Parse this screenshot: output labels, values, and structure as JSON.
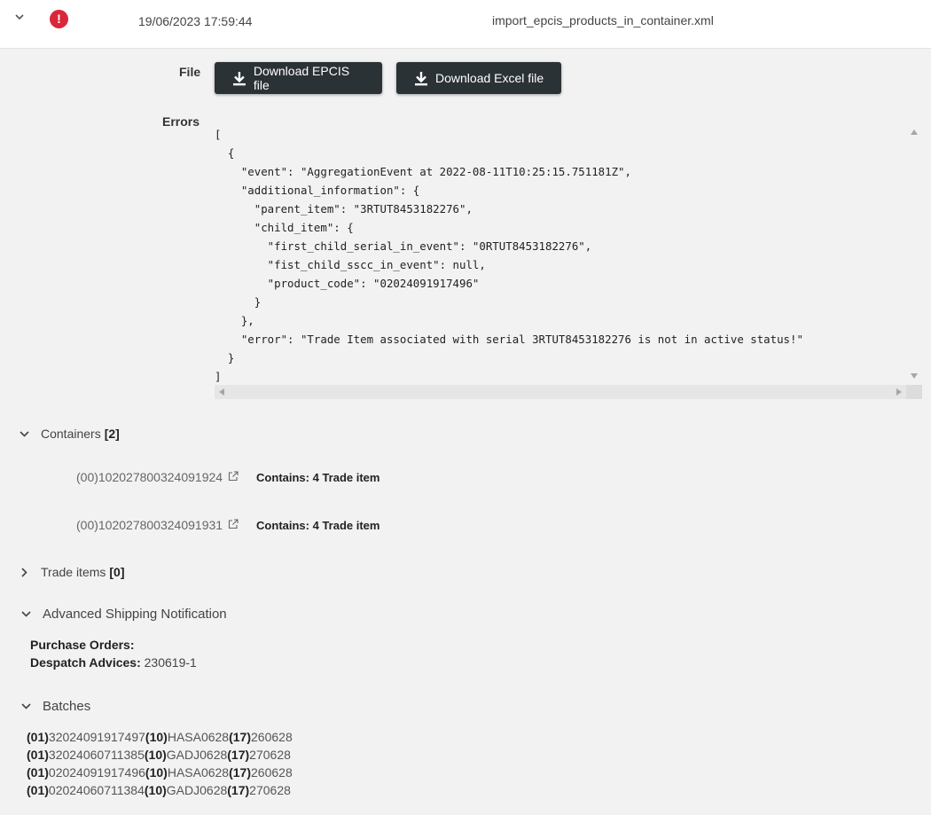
{
  "header": {
    "date": "19/06/2023 17:59:44",
    "filename": "import_epcis_products_in_container.xml",
    "status_icon": "error-icon",
    "status_color": "#d9283a"
  },
  "file_section": {
    "label": "File",
    "download_epcis_label": "Download EPCIS file",
    "download_excel_label": "Download Excel file"
  },
  "errors_section": {
    "label": "Errors",
    "json_lines": [
      "[",
      "  {",
      "    \"event\": \"AggregationEvent at 2022-08-11T10:25:15.751181Z\",",
      "    \"additional_information\": {",
      "      \"parent_item\": \"3RTUT8453182276\",",
      "      \"child_item\": {",
      "        \"first_child_serial_in_event\": \"0RTUT8453182276\",",
      "        \"fist_child_sscc_in_event\": null,",
      "        \"product_code\": \"02024091917496\"",
      "      }",
      "    },",
      "    \"error\": \"Trade Item associated with serial 3RTUT8453182276 is not in active status!\"",
      "  }",
      "]"
    ]
  },
  "containers": {
    "title": "Containers",
    "count": "[2]",
    "items": [
      {
        "code": "(00)102027800324091924",
        "contains": "Contains: 4 Trade item"
      },
      {
        "code": "(00)102027800324091931",
        "contains": "Contains: 4 Trade item"
      }
    ]
  },
  "trade_items": {
    "title": "Trade items",
    "count": "[0]"
  },
  "asn": {
    "title": "Advanced Shipping Notification",
    "purchase_orders_label": "Purchase Orders:",
    "purchase_orders_value": "",
    "despatch_advices_label": "Despatch Advices:",
    "despatch_advices_value": "230619-1"
  },
  "batches": {
    "title": "Batches",
    "items": [
      {
        "ai1": "(01)",
        "v1": "32024091917497",
        "ai2": "(10)",
        "v2": "HASA0628",
        "ai3": "(17)",
        "v3": "260628"
      },
      {
        "ai1": "(01)",
        "v1": "32024060711385",
        "ai2": "(10)",
        "v2": "GADJ0628",
        "ai3": "(17)",
        "v3": "270628"
      },
      {
        "ai1": "(01)",
        "v1": "02024091917496",
        "ai2": "(10)",
        "v2": "HASA0628",
        "ai3": "(17)",
        "v3": "260628"
      },
      {
        "ai1": "(01)",
        "v1": "02024060711384",
        "ai2": "(10)",
        "v2": "GADJ0628",
        "ai3": "(17)",
        "v3": "270628"
      }
    ]
  }
}
